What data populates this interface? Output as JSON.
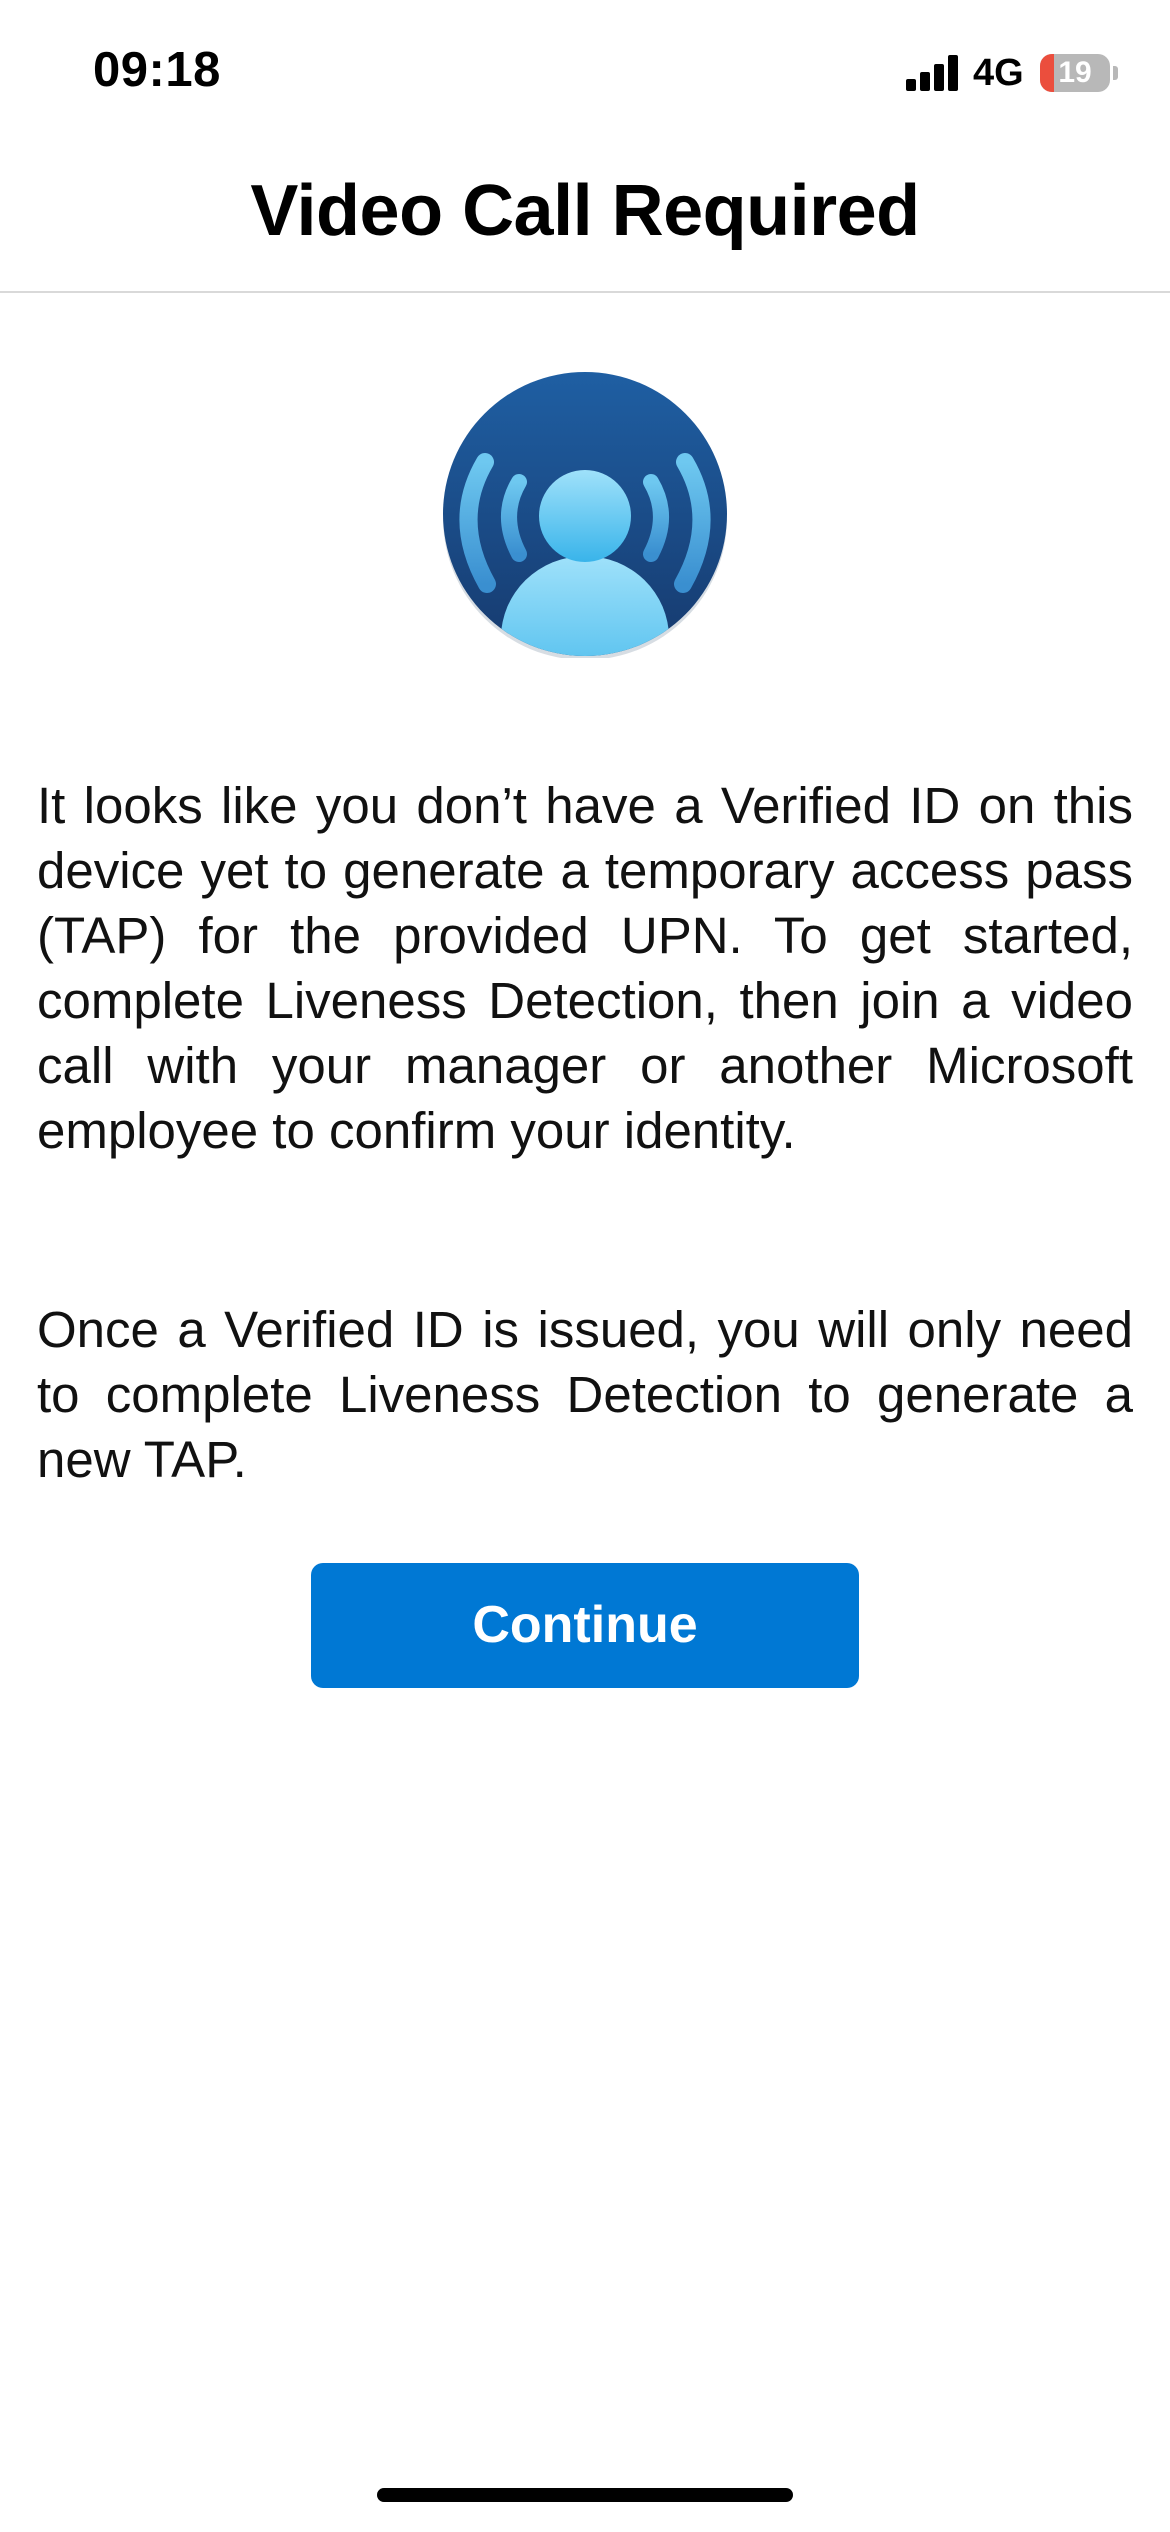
{
  "status_bar": {
    "time": "09:18",
    "network": "4G",
    "battery_level": "19",
    "battery_color": "#eb4e3d"
  },
  "header": {
    "title": "Video Call Required"
  },
  "logo": {
    "icon": "verified-id-person-broadcast-icon",
    "colors": [
      "#1c4f8f",
      "#3fa9e6",
      "#8fd8f7"
    ]
  },
  "body": {
    "paragraph1": "It looks like you don’t have a Verified ID on this device yet to generate a temporary access pass (TAP) for the provided UPN. To get started, complete Liveness Detection, then join a video call with your manager or another Microsoft employee to confirm your identity.",
    "paragraph2": "Once a Verified ID is issued, you will only need to complete Liveness Detection to generate a new TAP."
  },
  "actions": {
    "continue_label": "Continue",
    "accent_color": "#0078d4"
  }
}
